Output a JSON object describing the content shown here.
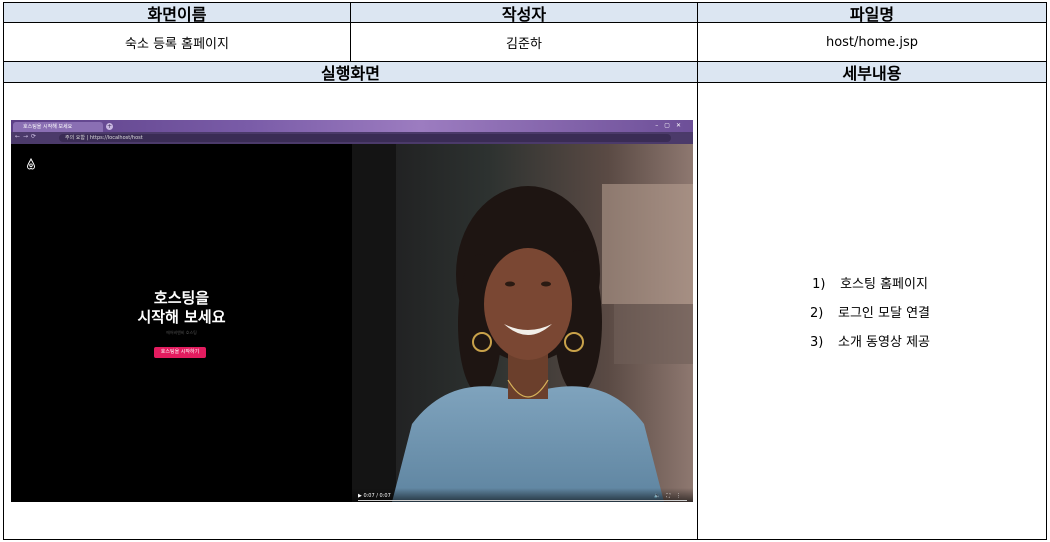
{
  "doc": {
    "screen_name_header": "화면이름",
    "author_header": "작성자",
    "file_name_header": "파일명",
    "screen_name": "숙소 등록 홈페이지",
    "author": "김준하",
    "file_name": "host/home.jsp",
    "run_screen_header": "실행화면",
    "details_header": "세부내용",
    "details": [
      {
        "num": "1)",
        "text": "호스팅 홈페이지"
      },
      {
        "num": "2)",
        "text": "로그인 모달 연결"
      },
      {
        "num": "3)",
        "text": "소개 동영상 제공"
      }
    ]
  },
  "screenshot": {
    "tab_title": "호스팅을 시작해 보세요",
    "address": "주의 요함 | https://localhost/host",
    "hero_line1": "호스팅을",
    "hero_line2": "시작해 보세요",
    "hero_subtitle": "에어비앤비 호스팅",
    "hero_button": "호스팅을 시작하기",
    "video_time": "0:07 / 0:07",
    "brand_color": "#e31c5f"
  }
}
